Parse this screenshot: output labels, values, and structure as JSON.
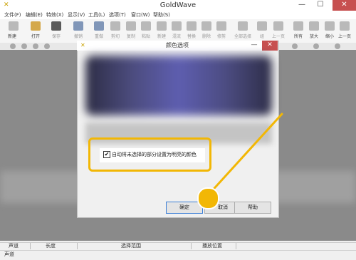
{
  "app": {
    "title": "GoldWave"
  },
  "window_controls": {
    "minimize": "—",
    "maximize": "☐",
    "close": "✕"
  },
  "menu": [
    "文件(F)",
    "编辑(E)",
    "特效(X)",
    "显示(V)",
    "工具(L)",
    "选项(T)",
    "窗口(W)",
    "帮助(S)"
  ],
  "toolbar": {
    "items": [
      {
        "label": "新建"
      },
      {
        "label": "打开"
      },
      {
        "label": "保存"
      },
      {
        "label": "撤销"
      },
      {
        "label": "重做"
      },
      {
        "label": "剪切"
      },
      {
        "label": "复制"
      },
      {
        "label": "粘贴"
      },
      {
        "label": "新建"
      },
      {
        "label": "混流"
      },
      {
        "label": "替换"
      },
      {
        "label": "删除"
      },
      {
        "label": "修剪"
      },
      {
        "label": "全部选择"
      },
      {
        "label": "组"
      },
      {
        "label": "上一页"
      },
      {
        "label": "所有"
      },
      {
        "label": "放大"
      },
      {
        "label": "缩小"
      },
      {
        "label": "上一页"
      }
    ]
  },
  "dialog": {
    "title": "颜色选项",
    "checkbox_label": "自动将未选择的部分设置为明亮的颜色",
    "checkbox_checked": "✔",
    "buttons": {
      "ok": "确定",
      "cancel": "取消",
      "help": "帮助"
    }
  },
  "status": {
    "row1": [
      "声道",
      "长度",
      "选择范围",
      "播放位置"
    ],
    "row2": "声道"
  },
  "colors": {
    "highlight": "#f2b705",
    "close_button": "#c75050",
    "preview_accent": "#5e5eb0"
  }
}
